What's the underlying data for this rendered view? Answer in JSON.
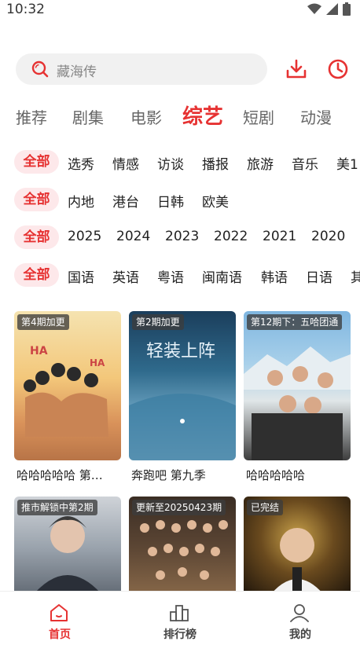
{
  "status": {
    "time": "10:32"
  },
  "search": {
    "placeholder": "藏海传"
  },
  "colors": {
    "accent": "#e63232",
    "pill_bg": "#fde8ea"
  },
  "categories": [
    "推荐",
    "剧集",
    "电影",
    "综艺",
    "短剧",
    "动漫"
  ],
  "active_category": "综艺",
  "filters": {
    "genre": {
      "selected": "全部",
      "options": [
        "选秀",
        "情感",
        "访谈",
        "播报",
        "旅游",
        "音乐",
        "美1"
      ]
    },
    "region": {
      "selected": "全部",
      "options": [
        "内地",
        "港台",
        "日韩",
        "欧美"
      ]
    },
    "year": {
      "selected": "全部",
      "options": [
        "2025",
        "2024",
        "2023",
        "2022",
        "2021",
        "2020"
      ]
    },
    "language": {
      "selected": "全部",
      "options": [
        "国语",
        "英语",
        "粤语",
        "闽南语",
        "韩语",
        "日语",
        "其"
      ]
    }
  },
  "cards": [
    {
      "badge": "第4期加更",
      "title": "哈哈哈哈哈 第…"
    },
    {
      "badge": "第2期加更",
      "title": "奔跑吧 第九季"
    },
    {
      "badge": "第12期下：五哈团通",
      "title": "哈哈哈哈哈"
    },
    {
      "badge": "推市解锁中第2期",
      "title": ""
    },
    {
      "badge": "更新至20250423期",
      "title": ""
    },
    {
      "badge": "已完结",
      "title": ""
    }
  ],
  "bottom_nav": [
    {
      "label": "首页",
      "icon": "home-icon",
      "active": true
    },
    {
      "label": "排行榜",
      "icon": "ranking-icon",
      "active": false
    },
    {
      "label": "我的",
      "icon": "profile-icon",
      "active": false
    }
  ]
}
